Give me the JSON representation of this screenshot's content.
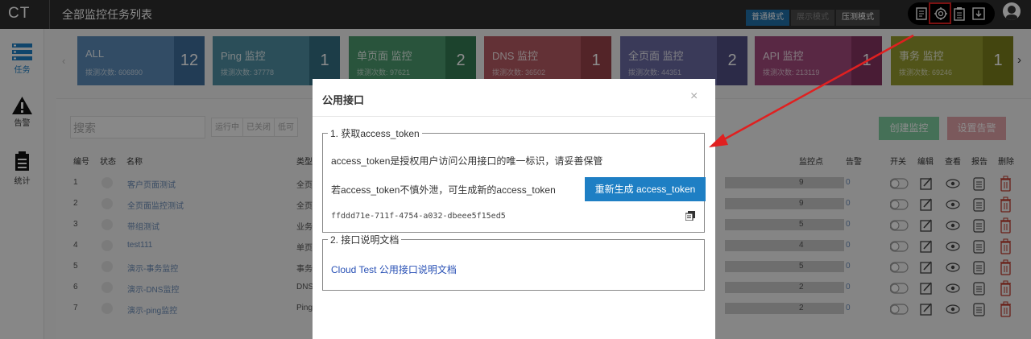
{
  "header": {
    "logo": "CT",
    "title": "全部监控任务列表"
  },
  "modes": [
    {
      "label": "普通模式",
      "state": "active"
    },
    {
      "label": "展示模式",
      "state": "dim"
    },
    {
      "label": "压测模式",
      "state": "normal"
    }
  ],
  "toolbar_icons": [
    "report-icon",
    "api-icon",
    "clipboard-icon",
    "download-icon"
  ],
  "sidebar": [
    {
      "label": "任务",
      "icon": "task-list-icon"
    },
    {
      "label": "告警",
      "icon": "alert-icon"
    },
    {
      "label": "统计",
      "icon": "stats-icon"
    }
  ],
  "cards": [
    {
      "name": "ALL",
      "count_label": "拨测次数: 606890",
      "num": "12",
      "color": "#5b8bb8",
      "num_color": "#3f6e9c"
    },
    {
      "name": "Ping 监控",
      "count_label": "拨测次数: 37778",
      "num": "1",
      "color": "#4f8fa3",
      "num_color": "#346f84"
    },
    {
      "name": "单页面 监控",
      "count_label": "拨测次数: 97621",
      "num": "2",
      "color": "#4c9a6e",
      "num_color": "#337a53"
    },
    {
      "name": "DNS 监控",
      "count_label": "拨测次数: 36502",
      "num": "1",
      "color": "#b55a63",
      "num_color": "#974249"
    },
    {
      "name": "全页面 监控",
      "count_label": "拨测次数: 44351",
      "num": "2",
      "color": "#6b6aa2",
      "num_color": "#514f84"
    },
    {
      "name": "API 监控",
      "count_label": "拨测次数: 213119",
      "num": "1",
      "color": "#a24a7c",
      "num_color": "#863462"
    },
    {
      "name": "事务 监控",
      "count_label": "拨测次数: 69246",
      "num": "1",
      "color": "#949a2e",
      "num_color": "#7a7f1c"
    }
  ],
  "search": {
    "placeholder": "搜索"
  },
  "filters": [
    "运行中",
    "已关闭",
    "低可"
  ],
  "actions": {
    "create": "创建监控",
    "alarm": "设置告警"
  },
  "table": {
    "headers": {
      "id": "编号",
      "status": "状态",
      "name": "名称",
      "type": "类型",
      "points": "监控点",
      "alarm": "告警",
      "switch": "开关",
      "edit": "编辑",
      "view": "查看",
      "report": "报告",
      "delete": "删除"
    },
    "rows": [
      {
        "id": "1",
        "name": "客户页面测试",
        "type": "全页",
        "points": "9",
        "alarm": "0"
      },
      {
        "id": "2",
        "name": "全页面监控测试",
        "type": "全页",
        "points": "9",
        "alarm": "0"
      },
      {
        "id": "3",
        "name": "带组测试",
        "type": "业务",
        "points": "5",
        "alarm": "0"
      },
      {
        "id": "4",
        "name": "test111",
        "type": "单页",
        "points": "4",
        "alarm": "0"
      },
      {
        "id": "5",
        "name": "演示-事务监控",
        "type": "事务",
        "points": "5",
        "alarm": "0"
      },
      {
        "id": "6",
        "name": "演示-DNS监控",
        "type": "DNS",
        "points": "2",
        "alarm": "0"
      },
      {
        "id": "7",
        "name": "演示-ping监控",
        "type": "Ping",
        "points": "2",
        "alarm": "0"
      }
    ]
  },
  "modal": {
    "title": "公用接口",
    "close": "×",
    "section1": {
      "legend": "1. 获取access_token",
      "desc": "access_token是授权用户访问公用接口的唯一标识，请妥善保管",
      "leak_text": "若access_token不慎外泄，可生成新的access_token",
      "button": "重新生成 access_token",
      "token": "ffddd71e-711f-4754-a032-dbeee5f15ed5"
    },
    "section2": {
      "legend": "2. 接口说明文档",
      "link": "Cloud Test 公用接口说明文档"
    }
  },
  "colors": {
    "accent": "#1e7fc4",
    "highlight": "#e02020",
    "topbar": "#2f2f2f"
  }
}
